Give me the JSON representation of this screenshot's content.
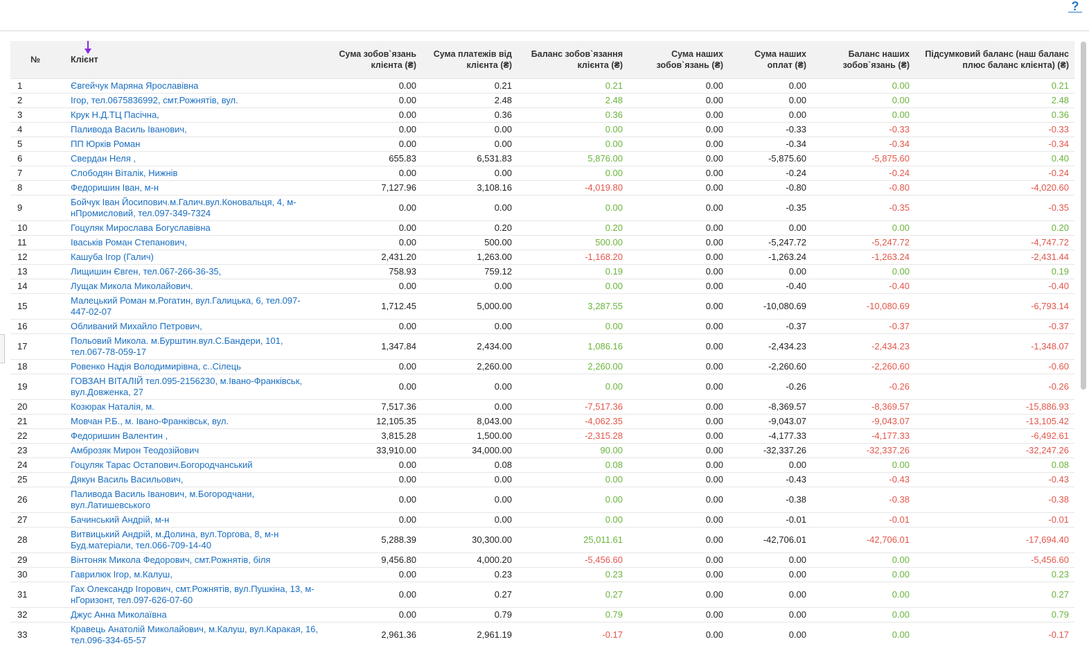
{
  "help_glyph": "?",
  "headers": {
    "idx": "№",
    "client": "Клієнт",
    "c1": "Сума зобов`язань клієнта (₴)",
    "c2": "Сума платежів від клієнта (₴)",
    "c3": "Баланс зобов`язання клієнта (₴)",
    "c4": "Сума наших зобов`язань (₴)",
    "c5": "Сума наших оплат (₴)",
    "c6": "Баланс наших зобов`язань (₴)",
    "c7": "Підсумковий баланс (наш баланс плюс баланс клієнта) (₴)"
  },
  "colors": {
    "positive": "#6ab43c",
    "negative": "#e2564a",
    "link": "#1a6ec0",
    "sort_arrow": "#8a2be2"
  },
  "rows": [
    [
      "1",
      "Євгейчук Маряна Ярославівна",
      "0.00",
      "0.21",
      "0.21",
      "0.00",
      "0.00",
      "0.00",
      "0.21"
    ],
    [
      "2",
      "Ігор, тел.0675836992, смт.Рожнятів, вул.",
      "0.00",
      "2.48",
      "2.48",
      "0.00",
      "0.00",
      "0.00",
      "2.48"
    ],
    [
      "3",
      "Крук Н.Д.ТЦ Пасічна,",
      "0.00",
      "0.36",
      "0.36",
      "0.00",
      "0.00",
      "0.00",
      "0.36"
    ],
    [
      "4",
      "Паливода Василь Іванович,",
      "0.00",
      "0.00",
      "0.00",
      "0.00",
      "-0.33",
      "-0.33",
      "-0.33"
    ],
    [
      "5",
      "ПП Юрків Роман",
      "0.00",
      "0.00",
      "0.00",
      "0.00",
      "-0.34",
      "-0.34",
      "-0.34"
    ],
    [
      "6",
      "Свердан Неля ,",
      "655.83",
      "6,531.83",
      "5,876.00",
      "0.00",
      "-5,875.60",
      "-5,875.60",
      "0.40"
    ],
    [
      "7",
      "Слободян Віталік, Нижнів",
      "0.00",
      "0.00",
      "0.00",
      "0.00",
      "-0.24",
      "-0.24",
      "-0.24"
    ],
    [
      "8",
      "Федоришин Іван, м-н",
      "7,127.96",
      "3,108.16",
      "-4,019.80",
      "0.00",
      "-0.80",
      "-0.80",
      "-4,020.60"
    ],
    [
      "9",
      "Бойчук Іван Йосипович.м.Галич.вул.Коновальця, 4, м-нПромисловий, тел.097-349-7324",
      "0.00",
      "0.00",
      "0.00",
      "0.00",
      "-0.35",
      "-0.35",
      "-0.35"
    ],
    [
      "10",
      "Гоцуляк Мирослава Богуславівна",
      "0.00",
      "0.20",
      "0.20",
      "0.00",
      "0.00",
      "0.00",
      "0.20"
    ],
    [
      "11",
      "Іваськів Роман Степанович,",
      "0.00",
      "500.00",
      "500.00",
      "0.00",
      "-5,247.72",
      "-5,247.72",
      "-4,747.72"
    ],
    [
      "12",
      "Кашуба Ігор (Галич)",
      "2,431.20",
      "1,263.00",
      "-1,168.20",
      "0.00",
      "-1,263.24",
      "-1,263.24",
      "-2,431.44"
    ],
    [
      "13",
      "Лищишин Євген, тел.067-266-36-35,",
      "758.93",
      "759.12",
      "0.19",
      "0.00",
      "0.00",
      "0.00",
      "0.19"
    ],
    [
      "14",
      "Лущак Микола Миколайович.",
      "0.00",
      "0.00",
      "0.00",
      "0.00",
      "-0.40",
      "-0.40",
      "-0.40"
    ],
    [
      "15",
      "Малецький Роман м.Рогатин, вул.Галицька, 6, тел.097-447-02-07",
      "1,712.45",
      "5,000.00",
      "3,287.55",
      "0.00",
      "-10,080.69",
      "-10,080.69",
      "-6,793.14"
    ],
    [
      "16",
      "Обливаний Михайло Петрович,",
      "0.00",
      "0.00",
      "0.00",
      "0.00",
      "-0.37",
      "-0.37",
      "-0.37"
    ],
    [
      "17",
      "Польовий Микола. м.Бурштин.вул.С.Бандери, 101, тел.067-78-059-17",
      "1,347.84",
      "2,434.00",
      "1,086.16",
      "0.00",
      "-2,434.23",
      "-2,434.23",
      "-1,348.07"
    ],
    [
      "18",
      "Ровенко Надія Володимирівна, с..Сілець",
      "0.00",
      "2,260.00",
      "2,260.00",
      "0.00",
      "-2,260.60",
      "-2,260.60",
      "-0.60"
    ],
    [
      "19",
      "ГОВЗАН ВІТАЛІЙ тел.095-2156230, м.Івано-Франківськ, вул.Довженка, 27",
      "0.00",
      "0.00",
      "0.00",
      "0.00",
      "-0.26",
      "-0.26",
      "-0.26"
    ],
    [
      "20",
      "Козюрак Наталія, м.",
      "7,517.36",
      "0.00",
      "-7,517.36",
      "0.00",
      "-8,369.57",
      "-8,369.57",
      "-15,886.93"
    ],
    [
      "21",
      "Мовчан Р.Б., м. Івано-Франківськ, вул.",
      "12,105.35",
      "8,043.00",
      "-4,062.35",
      "0.00",
      "-9,043.07",
      "-9,043.07",
      "-13,105.42"
    ],
    [
      "22",
      "Федоришин Валентин ,",
      "3,815.28",
      "1,500.00",
      "-2,315.28",
      "0.00",
      "-4,177.33",
      "-4,177.33",
      "-6,492.61"
    ],
    [
      "23",
      "Амброзяк Мирон Теодозійович",
      "33,910.00",
      "34,000.00",
      "90.00",
      "0.00",
      "-32,337.26",
      "-32,337.26",
      "-32,247.26"
    ],
    [
      "24",
      "Гоцуляк Тарас Остапович.Богородчанський",
      "0.00",
      "0.08",
      "0.08",
      "0.00",
      "0.00",
      "0.00",
      "0.08"
    ],
    [
      "25",
      "Дякун Василь Васильович,",
      "0.00",
      "0.00",
      "0.00",
      "0.00",
      "-0.43",
      "-0.43",
      "-0.43"
    ],
    [
      "26",
      "Паливода Василь Іванович, м.Богородчани, вул.Латишевського",
      "0.00",
      "0.00",
      "0.00",
      "0.00",
      "-0.38",
      "-0.38",
      "-0.38"
    ],
    [
      "27",
      "Бачинський Андрій, м-н",
      "0.00",
      "0.00",
      "0.00",
      "0.00",
      "-0.01",
      "-0.01",
      "-0.01"
    ],
    [
      "28",
      "Витвицький Андрій, м.Долина, вул.Торгова, 8, м-н Буд.матеріали, тел.066-709-14-40",
      "5,288.39",
      "30,300.00",
      "25,011.61",
      "0.00",
      "-42,706.01",
      "-42,706.01",
      "-17,694.40"
    ],
    [
      "29",
      "Вінтоняк Микола Федорович, смт.Рожнятів, біля",
      "9,456.80",
      "4,000.20",
      "-5,456.60",
      "0.00",
      "0.00",
      "0.00",
      "-5,456.60"
    ],
    [
      "30",
      "Гаврилюк Ігор, м.Калуш,",
      "0.00",
      "0.23",
      "0.23",
      "0.00",
      "0.00",
      "0.00",
      "0.23"
    ],
    [
      "31",
      "Гах Олександр Ігорович, смт.Рожнятів, вул.Пушкіна, 13, м-нГоризонт, тел.097-626-07-60",
      "0.00",
      "0.27",
      "0.27",
      "0.00",
      "0.00",
      "0.00",
      "0.27"
    ],
    [
      "32",
      "Джус Анна Миколаївна",
      "0.00",
      "0.79",
      "0.79",
      "0.00",
      "0.00",
      "0.00",
      "0.79"
    ],
    [
      "33",
      "Кравець Анатолій Миколайович, м.Калуш, вул.Каракая, 16, тел.096-334-65-57",
      "2,961.36",
      "2,961.19",
      "-0.17",
      "0.00",
      "0.00",
      "0.00",
      "-0.17"
    ]
  ]
}
